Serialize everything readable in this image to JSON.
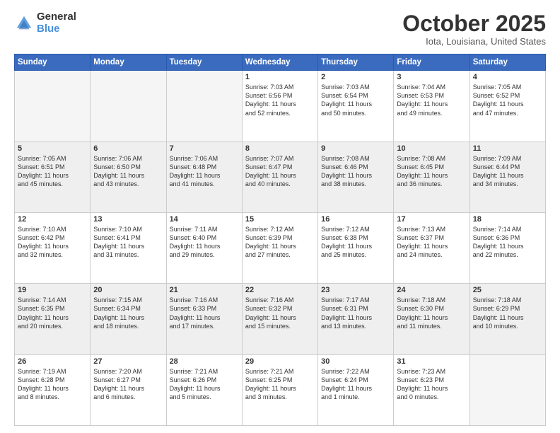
{
  "logo": {
    "general": "General",
    "blue": "Blue"
  },
  "header": {
    "month": "October 2025",
    "location": "Iota, Louisiana, United States"
  },
  "weekdays": [
    "Sunday",
    "Monday",
    "Tuesday",
    "Wednesday",
    "Thursday",
    "Friday",
    "Saturday"
  ],
  "weeks": [
    {
      "shaded": false,
      "days": [
        {
          "num": "",
          "info": "",
          "empty": true
        },
        {
          "num": "",
          "info": "",
          "empty": true
        },
        {
          "num": "",
          "info": "",
          "empty": true
        },
        {
          "num": "1",
          "info": "Sunrise: 7:03 AM\nSunset: 6:56 PM\nDaylight: 11 hours\nand 52 minutes.",
          "empty": false
        },
        {
          "num": "2",
          "info": "Sunrise: 7:03 AM\nSunset: 6:54 PM\nDaylight: 11 hours\nand 50 minutes.",
          "empty": false
        },
        {
          "num": "3",
          "info": "Sunrise: 7:04 AM\nSunset: 6:53 PM\nDaylight: 11 hours\nand 49 minutes.",
          "empty": false
        },
        {
          "num": "4",
          "info": "Sunrise: 7:05 AM\nSunset: 6:52 PM\nDaylight: 11 hours\nand 47 minutes.",
          "empty": false
        }
      ]
    },
    {
      "shaded": true,
      "days": [
        {
          "num": "5",
          "info": "Sunrise: 7:05 AM\nSunset: 6:51 PM\nDaylight: 11 hours\nand 45 minutes.",
          "empty": false
        },
        {
          "num": "6",
          "info": "Sunrise: 7:06 AM\nSunset: 6:50 PM\nDaylight: 11 hours\nand 43 minutes.",
          "empty": false
        },
        {
          "num": "7",
          "info": "Sunrise: 7:06 AM\nSunset: 6:48 PM\nDaylight: 11 hours\nand 41 minutes.",
          "empty": false
        },
        {
          "num": "8",
          "info": "Sunrise: 7:07 AM\nSunset: 6:47 PM\nDaylight: 11 hours\nand 40 minutes.",
          "empty": false
        },
        {
          "num": "9",
          "info": "Sunrise: 7:08 AM\nSunset: 6:46 PM\nDaylight: 11 hours\nand 38 minutes.",
          "empty": false
        },
        {
          "num": "10",
          "info": "Sunrise: 7:08 AM\nSunset: 6:45 PM\nDaylight: 11 hours\nand 36 minutes.",
          "empty": false
        },
        {
          "num": "11",
          "info": "Sunrise: 7:09 AM\nSunset: 6:44 PM\nDaylight: 11 hours\nand 34 minutes.",
          "empty": false
        }
      ]
    },
    {
      "shaded": false,
      "days": [
        {
          "num": "12",
          "info": "Sunrise: 7:10 AM\nSunset: 6:42 PM\nDaylight: 11 hours\nand 32 minutes.",
          "empty": false
        },
        {
          "num": "13",
          "info": "Sunrise: 7:10 AM\nSunset: 6:41 PM\nDaylight: 11 hours\nand 31 minutes.",
          "empty": false
        },
        {
          "num": "14",
          "info": "Sunrise: 7:11 AM\nSunset: 6:40 PM\nDaylight: 11 hours\nand 29 minutes.",
          "empty": false
        },
        {
          "num": "15",
          "info": "Sunrise: 7:12 AM\nSunset: 6:39 PM\nDaylight: 11 hours\nand 27 minutes.",
          "empty": false
        },
        {
          "num": "16",
          "info": "Sunrise: 7:12 AM\nSunset: 6:38 PM\nDaylight: 11 hours\nand 25 minutes.",
          "empty": false
        },
        {
          "num": "17",
          "info": "Sunrise: 7:13 AM\nSunset: 6:37 PM\nDaylight: 11 hours\nand 24 minutes.",
          "empty": false
        },
        {
          "num": "18",
          "info": "Sunrise: 7:14 AM\nSunset: 6:36 PM\nDaylight: 11 hours\nand 22 minutes.",
          "empty": false
        }
      ]
    },
    {
      "shaded": true,
      "days": [
        {
          "num": "19",
          "info": "Sunrise: 7:14 AM\nSunset: 6:35 PM\nDaylight: 11 hours\nand 20 minutes.",
          "empty": false
        },
        {
          "num": "20",
          "info": "Sunrise: 7:15 AM\nSunset: 6:34 PM\nDaylight: 11 hours\nand 18 minutes.",
          "empty": false
        },
        {
          "num": "21",
          "info": "Sunrise: 7:16 AM\nSunset: 6:33 PM\nDaylight: 11 hours\nand 17 minutes.",
          "empty": false
        },
        {
          "num": "22",
          "info": "Sunrise: 7:16 AM\nSunset: 6:32 PM\nDaylight: 11 hours\nand 15 minutes.",
          "empty": false
        },
        {
          "num": "23",
          "info": "Sunrise: 7:17 AM\nSunset: 6:31 PM\nDaylight: 11 hours\nand 13 minutes.",
          "empty": false
        },
        {
          "num": "24",
          "info": "Sunrise: 7:18 AM\nSunset: 6:30 PM\nDaylight: 11 hours\nand 11 minutes.",
          "empty": false
        },
        {
          "num": "25",
          "info": "Sunrise: 7:18 AM\nSunset: 6:29 PM\nDaylight: 11 hours\nand 10 minutes.",
          "empty": false
        }
      ]
    },
    {
      "shaded": false,
      "days": [
        {
          "num": "26",
          "info": "Sunrise: 7:19 AM\nSunset: 6:28 PM\nDaylight: 11 hours\nand 8 minutes.",
          "empty": false
        },
        {
          "num": "27",
          "info": "Sunrise: 7:20 AM\nSunset: 6:27 PM\nDaylight: 11 hours\nand 6 minutes.",
          "empty": false
        },
        {
          "num": "28",
          "info": "Sunrise: 7:21 AM\nSunset: 6:26 PM\nDaylight: 11 hours\nand 5 minutes.",
          "empty": false
        },
        {
          "num": "29",
          "info": "Sunrise: 7:21 AM\nSunset: 6:25 PM\nDaylight: 11 hours\nand 3 minutes.",
          "empty": false
        },
        {
          "num": "30",
          "info": "Sunrise: 7:22 AM\nSunset: 6:24 PM\nDaylight: 11 hours\nand 1 minute.",
          "empty": false
        },
        {
          "num": "31",
          "info": "Sunrise: 7:23 AM\nSunset: 6:23 PM\nDaylight: 11 hours\nand 0 minutes.",
          "empty": false
        },
        {
          "num": "",
          "info": "",
          "empty": true
        }
      ]
    }
  ]
}
